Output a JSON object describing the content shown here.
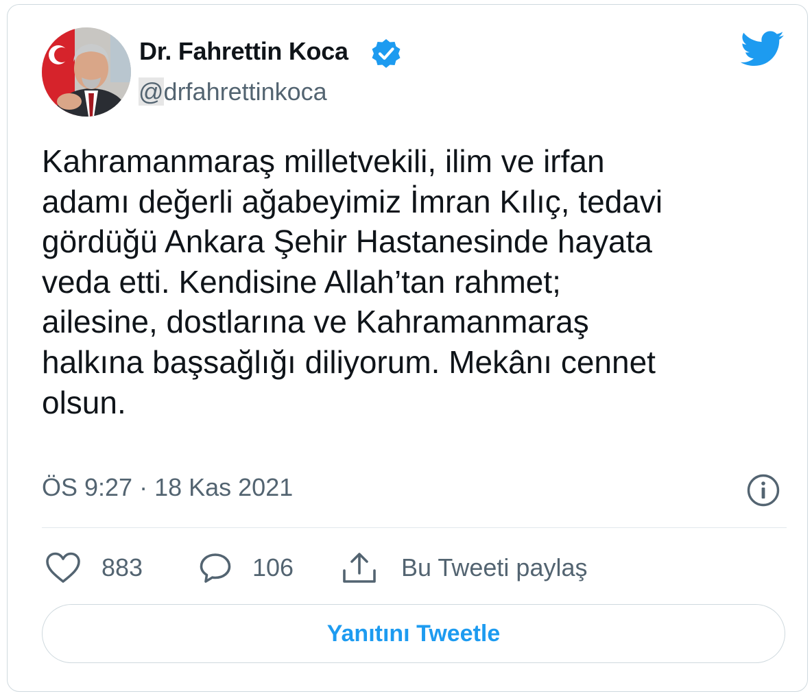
{
  "author": {
    "display_name": "Dr. Fahrettin Koca",
    "handle_at": "@",
    "handle_name": "drfahrettinkoca",
    "verified": true
  },
  "tweet": {
    "text_lines": [
      "Kahramanmaraş milletvekili, ilim ve irfan",
      "adamı değerli ağabeyimiz İmran Kılıç, tedavi",
      "gördüğü Ankara Şehir Hastanesinde hayata",
      "veda etti. Kendisine Allah’tan rahmet;",
      "ailesine, dostlarına ve Kahramanmaraş",
      "halkına başsağlığı diliyorum. Mekânı cennet",
      "olsun."
    ],
    "timestamp": "ÖS 9:27 · 18 Kas 2021"
  },
  "actions": {
    "likes": "883",
    "replies": "106",
    "share_label": "Bu Tweeti paylaş"
  },
  "reply_button_label": "Yanıtını Tweetle",
  "icons": {
    "twitter_logo": "twitter-bird-icon",
    "verified": "verified-badge-icon",
    "info": "info-icon",
    "like": "heart-icon",
    "reply": "comment-icon",
    "share": "share-icon"
  },
  "colors": {
    "brand_blue": "#1d9bf0",
    "text_primary": "#0f1419",
    "text_secondary": "#536471",
    "border": "#cfd9de"
  }
}
